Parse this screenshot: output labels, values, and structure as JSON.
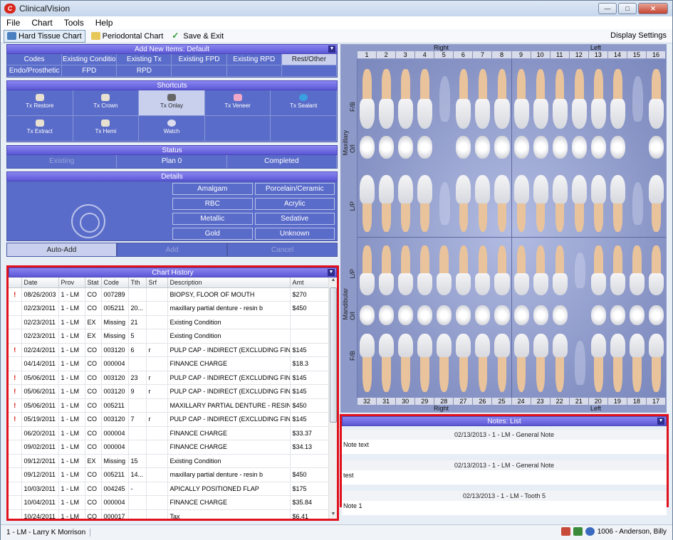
{
  "window": {
    "title": "ClinicalVision",
    "logo_text": "C"
  },
  "menu": [
    "File",
    "Chart",
    "Tools",
    "Help"
  ],
  "toolbar": {
    "hard_tissue": "Hard Tissue Chart",
    "perio": "Periodontal Chart",
    "save_exit": "Save & Exit",
    "display_settings": "Display Settings"
  },
  "add_new": {
    "header": "Add New Items: Default",
    "tabs_row1": [
      "Codes",
      "Existing Conditio",
      "Existing Tx",
      "Existing FPD",
      "Existing RPD",
      "Rest/Other"
    ],
    "tabs_row2": [
      "Endo/Prosthetic",
      "FPD",
      "RPD",
      "",
      "",
      ""
    ]
  },
  "shortcuts": {
    "header": "Shortcuts",
    "row1": [
      "Tx Restore",
      "Tx Crown",
      "Tx Onlay",
      "Tx Veneer",
      "Tx Sealant"
    ],
    "row2": [
      "Tx Extract",
      "Tx Hemi",
      "Watch",
      "",
      ""
    ]
  },
  "status": {
    "header": "Status",
    "items": [
      "Existing",
      "Plan 0",
      "Completed"
    ]
  },
  "details": {
    "header": "Details",
    "materials": [
      "Amalgam",
      "Porcelain/Ceramic",
      "RBC",
      "Acrylic",
      "Metallic",
      "Sedative",
      "Gold",
      "Unknown"
    ]
  },
  "actions": [
    "Auto-Add",
    "Add",
    "Cancel"
  ],
  "history": {
    "header": "Chart History",
    "columns": [
      "",
      "Date",
      "Prov",
      "Stat",
      "Code",
      "Tth",
      "Srf",
      "Description",
      "Amt"
    ],
    "rows": [
      [
        "!",
        "08/26/2003",
        "1 - LM",
        "CO",
        "007289",
        "",
        "",
        "BIOPSY, FLOOR OF MOUTH",
        "$270"
      ],
      [
        "",
        "02/23/2011",
        "1 - LM",
        "CO",
        "005211",
        "20...",
        "",
        "maxillary partial denture - resin b",
        "$450"
      ],
      [
        "",
        "02/23/2011",
        "1 - LM",
        "EX",
        "Missing",
        "21",
        "",
        "Existing Condition",
        ""
      ],
      [
        "",
        "02/23/2011",
        "1 - LM",
        "EX",
        "Missing",
        "5",
        "",
        "Existing Condition",
        ""
      ],
      [
        "!",
        "02/24/2011",
        "1 - LM",
        "CO",
        "003120",
        "6",
        "r",
        "PULP CAP - INDIRECT (EXCLUDING FINA",
        "$145"
      ],
      [
        "",
        "04/14/2011",
        "1 - LM",
        "CO",
        "000004",
        "",
        "",
        "FINANCE CHARGE",
        "$18.3"
      ],
      [
        "!",
        "05/06/2011",
        "1 - LM",
        "CO",
        "003120",
        "23",
        "r",
        "PULP CAP - INDIRECT (EXCLUDING FINA",
        "$145"
      ],
      [
        "!",
        "05/06/2011",
        "1 - LM",
        "CO",
        "003120",
        "9",
        "r",
        "PULP CAP - INDIRECT (EXCLUDING FINA",
        "$145"
      ],
      [
        "!",
        "05/06/2011",
        "1 - LM",
        "CO",
        "005211",
        "",
        "",
        "MAXILLARY PARTIAL DENTURE - RESIN B",
        "$450"
      ],
      [
        "!",
        "05/19/2011",
        "1 - LM",
        "CO",
        "003120",
        "7",
        "r",
        "PULP CAP - INDIRECT (EXCLUDING FINA",
        "$145"
      ],
      [
        "",
        "06/20/2011",
        "1 - LM",
        "CO",
        "000004",
        "",
        "",
        "FINANCE CHARGE",
        "$33.37"
      ],
      [
        "",
        "09/02/2011",
        "1 - LM",
        "CO",
        "000004",
        "",
        "",
        "FINANCE CHARGE",
        "$34.13"
      ],
      [
        "",
        "09/12/2011",
        "1 - LM",
        "EX",
        "Missing",
        "15",
        "",
        "Existing Condition",
        ""
      ],
      [
        "",
        "09/12/2011",
        "1 - LM",
        "CO",
        "005211",
        "14...",
        "",
        "maxillary partial denture - resin b",
        "$450"
      ],
      [
        "",
        "10/03/2011",
        "1 - LM",
        "CO",
        "004245",
        "-",
        "",
        "APICALLY POSITIONED FLAP",
        "$175"
      ],
      [
        "",
        "10/04/2011",
        "1 - LM",
        "CO",
        "000004",
        "",
        "",
        "FINANCE CHARGE",
        "$35.84"
      ],
      [
        "",
        "10/24/2011",
        "1 - LM",
        "CO",
        "000017",
        "",
        "",
        "Tax",
        "$6.41"
      ]
    ]
  },
  "chart": {
    "right_label": "Right",
    "left_label": "Left",
    "upper_numbers": [
      "1",
      "2",
      "3",
      "4",
      "5",
      "6",
      "7",
      "8",
      "9",
      "10",
      "11",
      "12",
      "13",
      "14",
      "15",
      "16"
    ],
    "lower_numbers": [
      "32",
      "31",
      "30",
      "29",
      "28",
      "27",
      "26",
      "25",
      "24",
      "23",
      "22",
      "21",
      "20",
      "19",
      "18",
      "17"
    ],
    "maxillary": "Maxillary",
    "mandibular": "Mandibular",
    "fb": "F/B",
    "ol": "O/I",
    "lp": "L/P"
  },
  "notes": {
    "header": "Notes: List",
    "items": [
      {
        "title": "02/13/2013 - 1 - LM - General Note",
        "text": "Note text"
      },
      {
        "title": "02/13/2013 - 1 - LM - General Note",
        "text": "test"
      },
      {
        "title": "02/13/2013 - 1 - LM - Tooth 5",
        "text": "Note 1"
      }
    ]
  },
  "statusbar": {
    "provider": "1 - LM - Larry K Morrison",
    "patient": "1006 - Anderson, Billy"
  },
  "colors": {
    "accent": "#5c58d6",
    "panel": "#5a6cc9",
    "highlight": "#e0111c",
    "flag": "#d20000"
  }
}
